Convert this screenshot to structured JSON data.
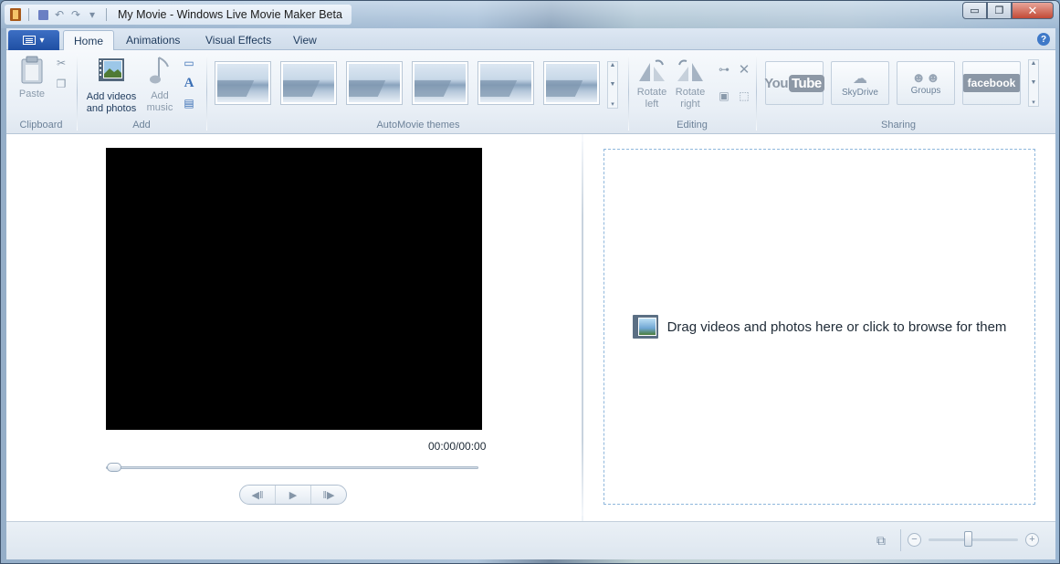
{
  "window": {
    "title": "My Movie - Windows Live Movie Maker Beta",
    "controls": {
      "minimize": "▭",
      "maximize": "❐",
      "close": "✕"
    }
  },
  "quick_access": [
    "save-icon",
    "undo-icon",
    "redo-icon",
    "customize-dropdown-icon"
  ],
  "ribbon": {
    "tabs": [
      "Home",
      "Animations",
      "Visual Effects",
      "View"
    ],
    "active_tab": "Home",
    "groups": {
      "clipboard": {
        "label": "Clipboard",
        "paste": "Paste"
      },
      "add": {
        "label": "Add",
        "add_videos_line1": "Add videos",
        "add_videos_line2": "and photos",
        "add_music_line1": "Add",
        "add_music_line2": "music"
      },
      "themes": {
        "label": "AutoMovie themes",
        "count": 6
      },
      "editing": {
        "label": "Editing",
        "rotate_left_line1": "Rotate",
        "rotate_left_line2": "left",
        "rotate_right_line1": "Rotate",
        "rotate_right_line2": "right"
      },
      "sharing": {
        "label": "Sharing",
        "youtube_a": "You",
        "youtube_b": "Tube",
        "skydrive": "SkyDrive",
        "groups": "Groups",
        "facebook": "facebook"
      }
    }
  },
  "preview": {
    "time": "00:00/00:00",
    "seek_position": 0
  },
  "storyboard": {
    "drop_text": "Drag videos and photos here or click to browse for them"
  },
  "status": {
    "zoom_level": 0.45
  }
}
